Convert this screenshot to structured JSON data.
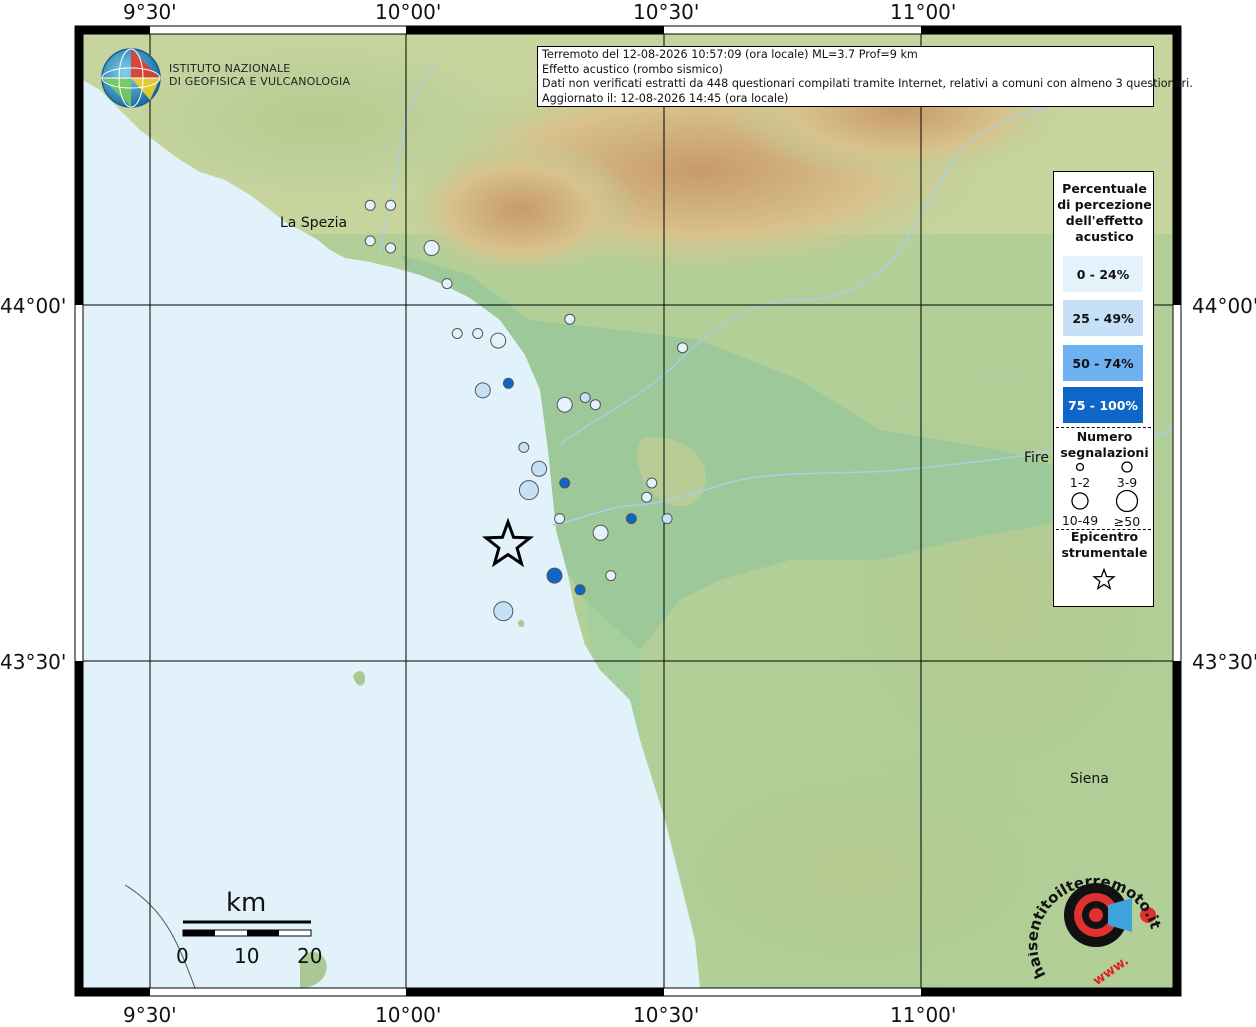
{
  "info": {
    "line1": "Terremoto del 12-08-2026 10:57:09 (ora locale) ML=3.7 Prof=9 km",
    "line2": "Effetto acustico (rombo sismico)",
    "line3": "Dati non verificati estratti da 448 questionari compilati tramite Internet, relativi a comuni con almeno 3 questionari.",
    "line4": "Aggiornato il: 12-08-2026 14:45 (ora locale)"
  },
  "logo": {
    "line1": "ISTITUTO NAZIONALE",
    "line2": "DI GEOFISICA E VULCANOLOGIA"
  },
  "axes": {
    "top": [
      "9°30'",
      "10°00'",
      "10°30'",
      "11°00'"
    ],
    "bottom": [
      "9°30'",
      "10°00'",
      "10°30'",
      "11°00'"
    ],
    "left": [
      "44°00'",
      "43°30'"
    ],
    "right": [
      "44°00'",
      "43°30'"
    ]
  },
  "places": {
    "la_spezia": "La Spezia",
    "firenze": "Fire",
    "siena": "Siena"
  },
  "legend": {
    "perc_title": "Percentuale di percezione dell'effetto acustico",
    "perc_lines": [
      "Percentuale",
      "di percezione",
      "dell'effetto",
      "acustico"
    ],
    "classes": [
      {
        "label": "0 - 24%",
        "color": "#e4f3fb"
      },
      {
        "label": "25 - 49%",
        "color": "#c6e0f7"
      },
      {
        "label": "50 - 74%",
        "color": "#6db1f1"
      },
      {
        "label": "75 - 100%",
        "color": "#0d66c8"
      }
    ],
    "num_lines": [
      "Numero",
      "segnalazioni"
    ],
    "size_labels": [
      "1-2",
      "3-9",
      "10-49",
      "≥50"
    ],
    "epi_lines": [
      "Epicentro",
      "strumentale"
    ]
  },
  "scale": {
    "title": "km",
    "ticks": [
      "0",
      "10",
      "20"
    ]
  },
  "watermark": {
    "text": "haisentitoilterremoto.it",
    "www": "www."
  },
  "colors": {
    "sea": "#e2f2fb",
    "plain": "#9dc89a",
    "grid": "#000000"
  },
  "epicenter": {
    "lon": 10.17,
    "lat": 43.66
  },
  "towns": [
    {
      "lon": 9.93,
      "lat": 44.14,
      "size": "3-9",
      "class": "0 - 24%"
    },
    {
      "lon": 9.97,
      "lat": 44.14,
      "size": "3-9",
      "class": "0 - 24%"
    },
    {
      "lon": 9.93,
      "lat": 44.09,
      "size": "3-9",
      "class": "0 - 24%"
    },
    {
      "lon": 9.97,
      "lat": 44.08,
      "size": "3-9",
      "class": "0 - 24%"
    },
    {
      "lon": 10.05,
      "lat": 44.08,
      "size": "10-49",
      "class": "0 - 24%"
    },
    {
      "lon": 10.08,
      "lat": 44.03,
      "size": "3-9",
      "class": "0 - 24%"
    },
    {
      "lon": 10.1,
      "lat": 43.96,
      "size": "3-9",
      "class": "0 - 24%"
    },
    {
      "lon": 10.14,
      "lat": 43.96,
      "size": "3-9",
      "class": "0 - 24%"
    },
    {
      "lon": 10.18,
      "lat": 43.95,
      "size": "10-49",
      "class": "0 - 24%"
    },
    {
      "lon": 10.15,
      "lat": 43.88,
      "size": "10-49",
      "class": "25 - 49%"
    },
    {
      "lon": 10.2,
      "lat": 43.89,
      "size": "3-9",
      "class": "75 - 100%"
    },
    {
      "lon": 10.32,
      "lat": 43.98,
      "size": "3-9",
      "class": "0 - 24%"
    },
    {
      "lon": 10.31,
      "lat": 43.86,
      "size": "10-49",
      "class": "0 - 24%"
    },
    {
      "lon": 10.35,
      "lat": 43.87,
      "size": "3-9",
      "class": "25 - 49%"
    },
    {
      "lon": 10.37,
      "lat": 43.86,
      "size": "3-9",
      "class": "0 - 24%"
    },
    {
      "lon": 10.23,
      "lat": 43.8,
      "size": "3-9",
      "class": "25 - 49%"
    },
    {
      "lon": 10.26,
      "lat": 43.77,
      "size": "10-49",
      "class": "25 - 49%"
    },
    {
      "lon": 10.24,
      "lat": 43.74,
      "size": "≥50",
      "class": "25 - 49%"
    },
    {
      "lon": 10.31,
      "lat": 43.75,
      "size": "3-9",
      "class": "75 - 100%"
    },
    {
      "lon": 10.3,
      "lat": 43.7,
      "size": "3-9",
      "class": "0 - 24%"
    },
    {
      "lon": 10.38,
      "lat": 43.68,
      "size": "10-49",
      "class": "0 - 24%"
    },
    {
      "lon": 10.44,
      "lat": 43.7,
      "size": "3-9",
      "class": "75 - 100%"
    },
    {
      "lon": 10.47,
      "lat": 43.73,
      "size": "3-9",
      "class": "0 - 24%"
    },
    {
      "lon": 10.48,
      "lat": 43.75,
      "size": "3-9",
      "class": "0 - 24%"
    },
    {
      "lon": 10.51,
      "lat": 43.7,
      "size": "3-9",
      "class": "25 - 49%"
    },
    {
      "lon": 10.54,
      "lat": 43.94,
      "size": "3-9",
      "class": "0 - 24%"
    },
    {
      "lon": 10.29,
      "lat": 43.62,
      "size": "10-49",
      "class": "75 - 100%"
    },
    {
      "lon": 10.34,
      "lat": 43.6,
      "size": "3-9",
      "class": "75 - 100%"
    },
    {
      "lon": 10.4,
      "lat": 43.62,
      "size": "3-9",
      "class": "0 - 24%"
    },
    {
      "lon": 10.19,
      "lat": 43.57,
      "size": "≥50",
      "class": "25 - 49%"
    }
  ]
}
